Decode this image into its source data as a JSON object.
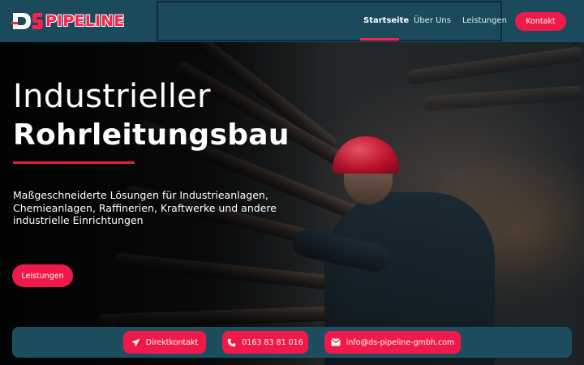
{
  "header": {
    "logo_text": "PIPELINE",
    "logo_mark": "DS",
    "nav": [
      {
        "label": "Startseite",
        "active": true
      },
      {
        "label": "Über Uns",
        "active": false
      },
      {
        "label": "Leistungen",
        "active": false
      }
    ],
    "contact_button": "Kontakt"
  },
  "hero": {
    "title_line1": "Industrieller",
    "title_line2": "Rohrleitungsbau",
    "subtitle": "Maßgeschneiderte Lösungen für Industrieanlagen, Chemieanlagen, Raffinerien, Kraftwerke und andere industrielle Einrichtungen",
    "cta_button": "Leistungen"
  },
  "contact_bar": {
    "direct_contact": {
      "label": "Direktkontakt",
      "icon": "paper-plane-icon"
    },
    "phone": {
      "label": "0163 83 81 016",
      "icon": "phone-icon"
    },
    "email": {
      "label": "info@ds-pipeline-gmbh.com",
      "icon": "envelope-icon"
    }
  },
  "colors": {
    "header_bg": "#1a4a5c",
    "accent": "#f0194a",
    "contact_bar_bg": "#1c4e60"
  }
}
